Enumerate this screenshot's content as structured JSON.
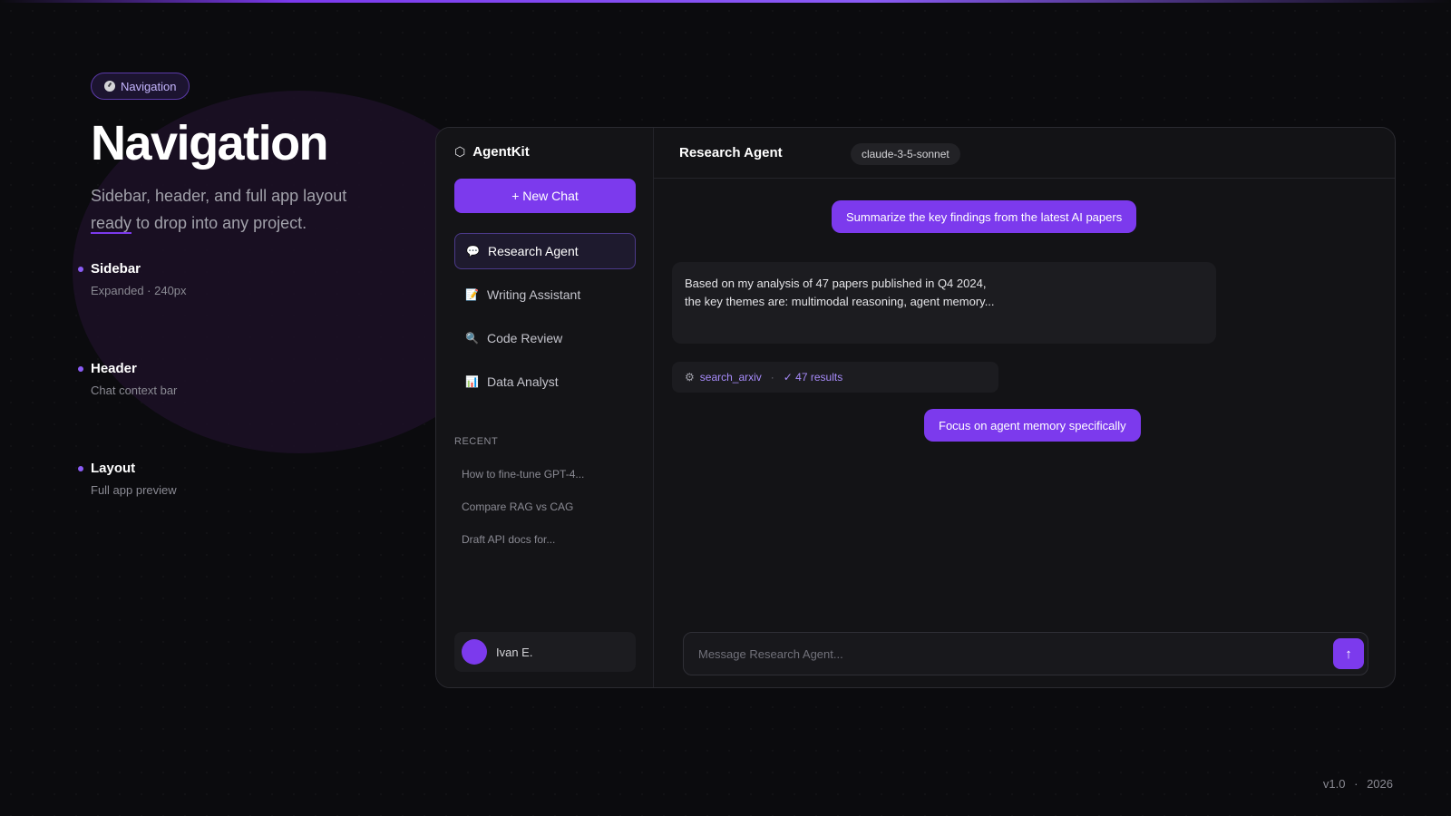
{
  "hero": {
    "pill_label": "Navigation",
    "title": "Navigation",
    "subtitle_part1": "Sidebar, header, and full app layout ",
    "subtitle_underlined": "ready",
    "subtitle_part2": " to drop into any project."
  },
  "features": [
    {
      "title": "Sidebar",
      "desc": "Expanded · 240px"
    },
    {
      "title": "Header",
      "desc": "Chat context bar"
    },
    {
      "title": "Layout",
      "desc": "Full app preview"
    }
  ],
  "app": {
    "brand": "AgentKit",
    "brand_icon": "⬡",
    "new_chat_label": "+ New Chat",
    "nav_items": [
      {
        "icon": "💬",
        "label": "Research Agent",
        "active": true
      },
      {
        "icon": "📝",
        "label": "Writing Assistant",
        "active": false
      },
      {
        "icon": "🔍",
        "label": "Code Review",
        "active": false
      },
      {
        "icon": "📊",
        "label": "Data Analyst",
        "active": false
      }
    ],
    "recent_label": "RECENT",
    "recent_items": [
      "How to fine-tune GPT-4...",
      "Compare RAG vs CAG",
      "Draft API docs for..."
    ],
    "user_name": "Ivan E.",
    "header_title": "Research Agent",
    "model": "claude-3-5-sonnet",
    "messages": {
      "user1": "Summarize the key findings from the latest AI papers",
      "bot_line1": "Based on my analysis of 47 papers published in Q4 2024,",
      "bot_line2": "the key themes are: multimodal reasoning, agent memory...",
      "tool_name": "search_arxiv",
      "tool_sep": "·",
      "tool_result": "✓ 47 results",
      "user2": "Focus on agent memory specifically"
    },
    "composer_placeholder": "Message Research Agent...",
    "send_icon": "↑"
  },
  "footer": {
    "version": "v1.0",
    "sep": "·",
    "year": "2026"
  },
  "colors": {
    "accent": "#7c3aed",
    "background": "#0b0b0e",
    "panel": "#131316"
  }
}
